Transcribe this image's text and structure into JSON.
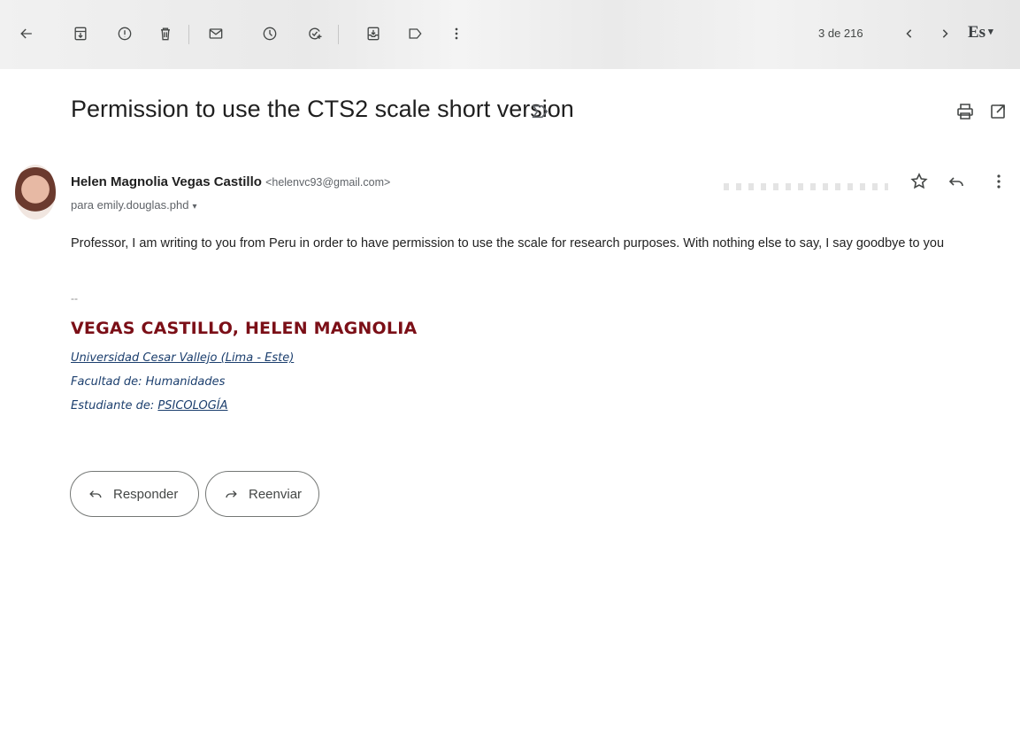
{
  "toolbar": {
    "back_icon": "arrow-left-icon",
    "archive_icon": "archive-icon",
    "spam_icon": "report-spam-icon",
    "delete_icon": "trash-icon",
    "mark_unread_icon": "envelope-icon",
    "snooze_icon": "clock-icon",
    "add_task_icon": "add-task-icon",
    "move_to_icon": "move-to-inbox-icon",
    "label_icon": "label-icon",
    "more_icon": "more-vertical-icon"
  },
  "pager": {
    "text": "3 de 216",
    "prev_icon": "chevron-left-icon",
    "next_icon": "chevron-right-icon"
  },
  "language": {
    "label": "Es",
    "caret": "▾"
  },
  "email": {
    "subject": "Permission to use the CTS2 scale short version",
    "sender_name": "Helen Magnolia Vegas Castillo",
    "sender_email": "<helenvc93@gmail.com>",
    "recipient_label": "para emily.douglas.phd",
    "recipient_caret": "▾",
    "body": "Professor, I am writing to you from Peru in order to have permission to use the scale for research purposes. With nothing else to say, I say goodbye to you",
    "signature": {
      "dash": "--",
      "name": "VEGAS CASTILLO, HELEN MAGNOLIA",
      "university": "Universidad Cesar Vallejo (Lima - Este)",
      "faculty": "Facultad de: Humanidades",
      "student_prefix": "Estudiante de: ",
      "student_field": "PSICOLOGÍA"
    }
  },
  "actions": {
    "reply": "Responder",
    "forward": "Reenviar"
  }
}
